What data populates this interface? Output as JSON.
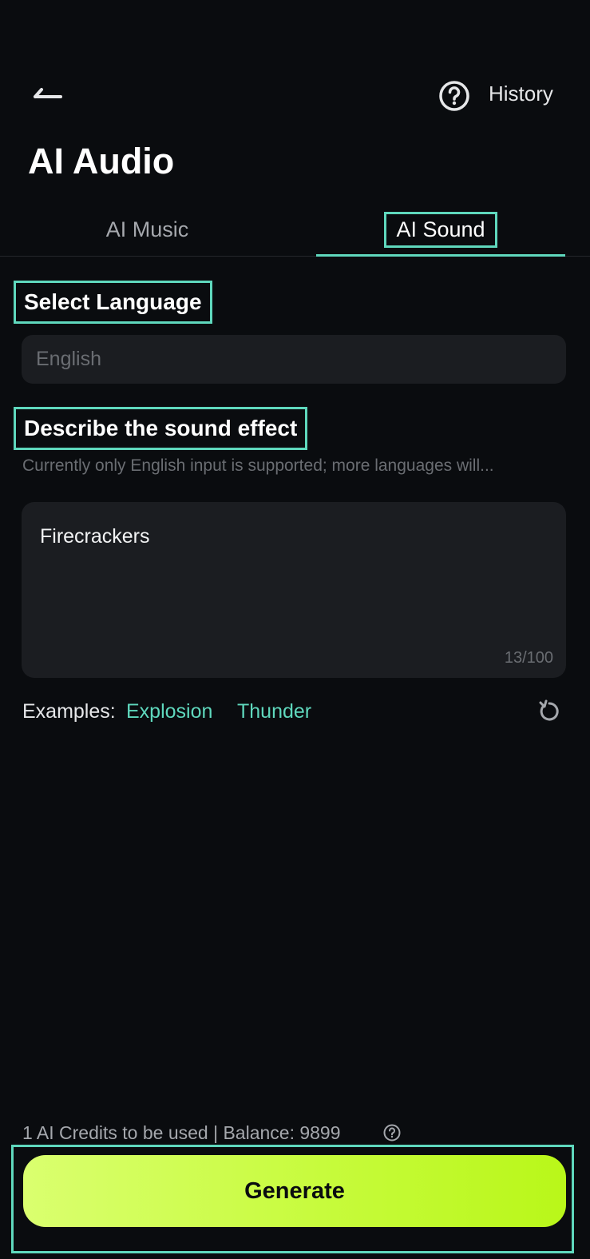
{
  "header": {
    "back_icon": "back-arrow-icon",
    "help_icon": "question-circle-icon",
    "history_label": "History",
    "title": "AI Audio"
  },
  "tabs": [
    {
      "label": "AI Music",
      "active": false
    },
    {
      "label": "AI Sound",
      "active": true
    }
  ],
  "language": {
    "label": "Select Language",
    "placeholder": "English"
  },
  "description": {
    "label": "Describe the sound effect",
    "hint": "Currently only English input is supported; more languages will...",
    "value": "Firecrackers",
    "counter": "13/100"
  },
  "examples": {
    "label": "Examples:",
    "items": [
      "Explosion",
      "Thunder"
    ],
    "refresh_icon": "refresh-icon"
  },
  "footer": {
    "credits_text": "1 AI Credits to be used |  Balance: 9899",
    "help_icon": "question-circle-icon",
    "generate_label": "Generate"
  },
  "colors": {
    "background": "#0a0c0f",
    "accent": "#5fd8bd",
    "button": "#c7fb3c",
    "field": "#1b1d21"
  }
}
